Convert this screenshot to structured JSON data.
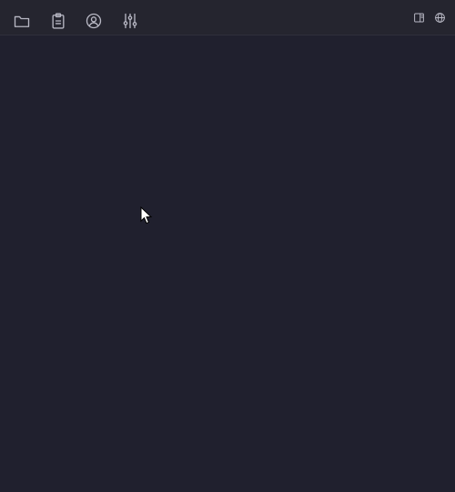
{
  "colors": {
    "background": "#20202e",
    "toolbar": "#25252f",
    "icon": "#b8b8c4"
  },
  "toolbar": {
    "left_icons": [
      "folder-icon",
      "clipboard-icon",
      "user-circle-icon",
      "sliders-icon"
    ],
    "right_icons": [
      "panel-toggle-icon",
      "globe-icon"
    ]
  }
}
